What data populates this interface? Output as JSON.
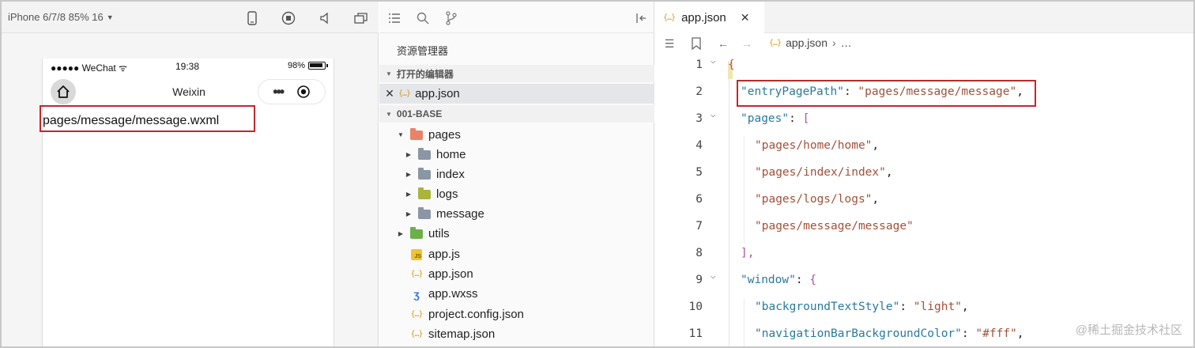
{
  "simulator": {
    "device_label": "iPhone 6/7/8 85% 16",
    "status": {
      "carrier": "●●●●● WeChat",
      "time": "19:38",
      "battery": "98%"
    },
    "nav_title": "Weixin",
    "capsule_dots": "•••",
    "page_text": "pages/message/message.wxml"
  },
  "explorer": {
    "title": "资源管理器",
    "open_editors_label": "打开的编辑器",
    "open_file": "app.json",
    "project_label": "001-BASE",
    "tree": [
      {
        "label": "pages"
      },
      {
        "label": "home"
      },
      {
        "label": "index"
      },
      {
        "label": "logs"
      },
      {
        "label": "message"
      },
      {
        "label": "utils"
      },
      {
        "label": "app.js"
      },
      {
        "label": "app.json"
      },
      {
        "label": "app.wxss"
      },
      {
        "label": "project.config.json"
      },
      {
        "label": "sitemap.json"
      }
    ],
    "js_badge": "JS"
  },
  "editor": {
    "tab_label": "app.json",
    "breadcrumb": {
      "file": "app.json",
      "tail": "…"
    },
    "json_icon": "{…}",
    "lines": [
      {
        "n": "1",
        "parts": [
          "{"
        ]
      },
      {
        "n": "2",
        "key": "\"entryPagePath\"",
        "sep": ": ",
        "val": "\"pages/message/message\"",
        "end": ","
      },
      {
        "n": "3",
        "key": "\"pages\"",
        "sep": ": ",
        "open": "["
      },
      {
        "n": "4",
        "val": "\"pages/home/home\"",
        "end": ","
      },
      {
        "n": "5",
        "val": "\"pages/index/index\"",
        "end": ","
      },
      {
        "n": "6",
        "val": "\"pages/logs/logs\"",
        "end": ","
      },
      {
        "n": "7",
        "val": "\"pages/message/message\""
      },
      {
        "n": "8",
        "close": "],",
        "end": ""
      },
      {
        "n": "9",
        "key": "\"window\"",
        "sep": ": ",
        "open": "{"
      },
      {
        "n": "10",
        "key": "\"backgroundTextStyle\"",
        "sep": ": ",
        "val": "\"light\"",
        "end": ","
      },
      {
        "n": "11",
        "key": "\"navigationBarBackgroundColor\"",
        "sep": ": ",
        "val": "\"#fff\"",
        "end": ","
      }
    ]
  },
  "watermark": "@稀土掘金技术社区",
  "colors": {
    "highlight": "#c0282d",
    "key": "#2a7a9b",
    "string": "#a1513a",
    "bracket": "#b64fa0"
  }
}
